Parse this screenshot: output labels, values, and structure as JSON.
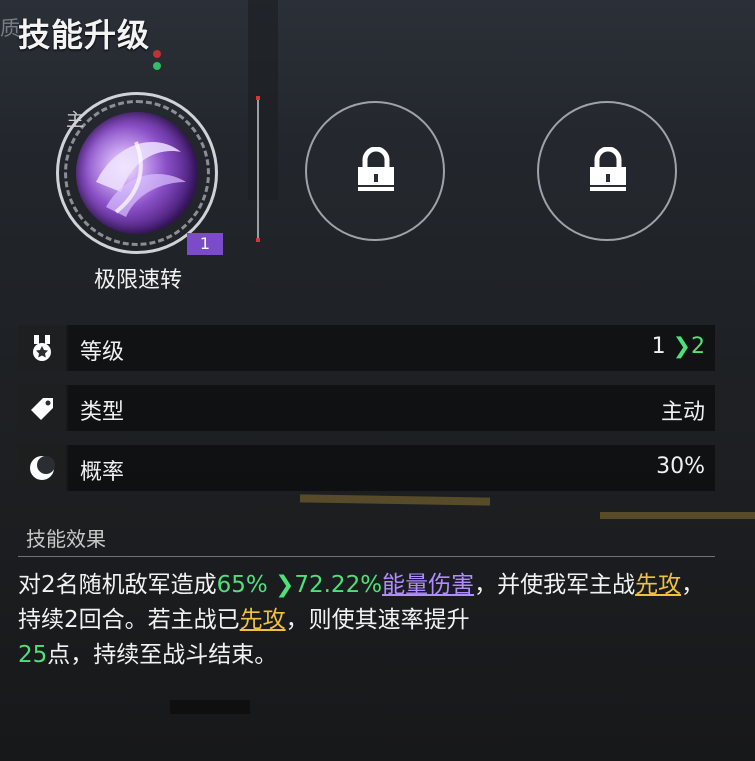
{
  "header": {
    "title_prefix": "质",
    "title": "技能升级"
  },
  "slots": {
    "main": {
      "tag": "主",
      "level": "1",
      "name": "极限速转"
    },
    "locked": [
      {
        "icon": "lock-icon"
      },
      {
        "icon": "lock-icon"
      }
    ]
  },
  "stats": {
    "level": {
      "icon": "medal-icon",
      "label": "等级",
      "from": "1",
      "to": "2"
    },
    "type": {
      "icon": "tag-icon",
      "label": "类型",
      "value": "主动"
    },
    "rate": {
      "icon": "moon-icon",
      "label": "概率",
      "value": "30%"
    }
  },
  "effect": {
    "title": "技能效果",
    "segments": [
      {
        "t": "对2名随机敌军造成",
        "c": ""
      },
      {
        "t": "65%",
        "c": "g"
      },
      {
        "t": "72.22%",
        "c": "g"
      },
      {
        "t": "能量伤害",
        "c": "p"
      },
      {
        "t": "，并使我军主战",
        "c": ""
      },
      {
        "t": "先攻",
        "c": "y"
      },
      {
        "t": "，持续2回合。若主战已",
        "c": ""
      },
      {
        "t": "先攻",
        "c": "y"
      },
      {
        "t": "，则使其速率提升",
        "c": ""
      },
      {
        "t": "25",
        "c": "g"
      },
      {
        "t": "点，持续至战斗结束。",
        "c": ""
      }
    ]
  },
  "colors": {
    "accent_green": "#4fe07a",
    "keyword_purple": "#b18cff",
    "keyword_yellow": "#f0c040",
    "badge_purple": "#7b4bc9"
  }
}
